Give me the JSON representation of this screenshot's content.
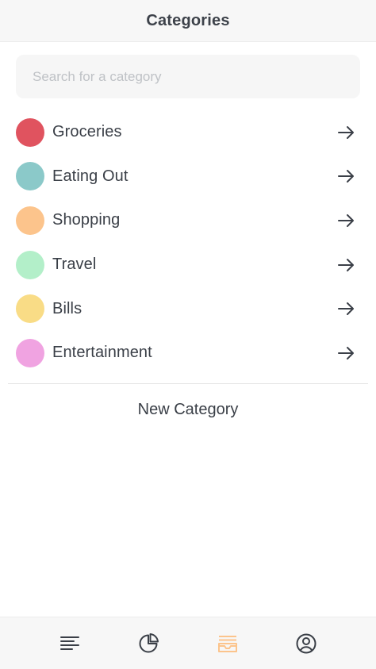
{
  "header": {
    "title": "Categories"
  },
  "search": {
    "placeholder": "Search for a category",
    "value": ""
  },
  "categories": [
    {
      "label": "Groceries",
      "color": "#e0535f"
    },
    {
      "label": "Eating Out",
      "color": "#8bc9c9"
    },
    {
      "label": "Shopping",
      "color": "#fcc48c"
    },
    {
      "label": "Travel",
      "color": "#b3efc9"
    },
    {
      "label": "Bills",
      "color": "#f9dc86"
    },
    {
      "label": "Entertainment",
      "color": "#f0a3e1"
    }
  ],
  "row_icon": "arrow-right-icon",
  "new_category_label": "New Category",
  "tabbar": {
    "active_color": "#fcc48c",
    "inactive_color": "#3a3f47",
    "tabs": [
      {
        "icon": "list-icon",
        "active": false
      },
      {
        "icon": "pie-chart-icon",
        "active": false
      },
      {
        "icon": "categories-icon",
        "active": true
      },
      {
        "icon": "profile-icon",
        "active": false
      }
    ]
  }
}
